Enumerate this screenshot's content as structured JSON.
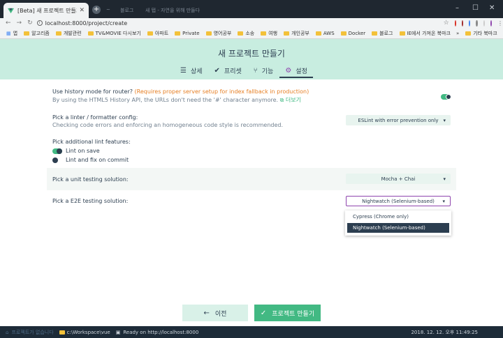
{
  "browser": {
    "tab_title": "[Beta] 새 프로젝트 만들기 - Vue",
    "dim_tabs": [
      "~",
      "블로그",
      "새 탭 - 자연을 위해 만들다"
    ],
    "url": "localhost:8000/project/create",
    "bookmarks": [
      "앱",
      "알고리즘",
      "개발관련",
      "TV&MOVIE 다시보기",
      "아파트",
      "Private",
      "영어공부",
      "소송",
      "여행",
      "개인공부",
      "AWS",
      "Docker",
      "블로그",
      "IE에서 가져온 북마크"
    ],
    "other_bookmarks": "기타 북마크"
  },
  "header": {
    "title": "새 프로젝트 만들기",
    "steps": [
      {
        "label": "상세",
        "icon": "list-icon"
      },
      {
        "label": "프리셋",
        "icon": "check-circle-icon"
      },
      {
        "label": "기능",
        "icon": "fork-icon"
      },
      {
        "label": "설정",
        "icon": "gear-icon"
      }
    ],
    "active_step": "설정"
  },
  "settings": {
    "history": {
      "label": "Use history mode for router?",
      "warning": "(Requires proper server setup for index fallback in production)",
      "desc": "By using the HTML5 History API, the URLs don't need the '#' character anymore.",
      "more": "더보기",
      "enabled": true
    },
    "linter": {
      "label": "Pick a linter / formatter config:",
      "desc": "Checking code errors and enforcing an homogeneous code style is recommended.",
      "value": "ESLint with error prevention only"
    },
    "lint_features": {
      "label": "Pick additional lint features:",
      "options": [
        {
          "label": "Lint on save",
          "enabled": true
        },
        {
          "label": "Lint and fix on commit",
          "enabled": false
        }
      ]
    },
    "unit": {
      "label": "Pick a unit testing solution:",
      "value": "Mocha + Chai"
    },
    "e2e": {
      "label": "Pick a E2E testing solution:",
      "value": "Nightwatch (Selenium-based)",
      "options": [
        "Cypress (Chrome only)",
        "Nightwatch (Selenium-based)"
      ]
    }
  },
  "buttons": {
    "prev": "이전",
    "create": "프로젝트 만들기"
  },
  "statusbar": {
    "left": "프로젝트가 없습니다",
    "path": "c:\\Workspace\\vue",
    "ready": "Ready on http://localhost:8000",
    "datetime": "2018. 12. 12. 오후 11:49:25"
  },
  "colors": {
    "accent": "#42b983",
    "header_bg": "#c8ede0",
    "text": "#2c3e50",
    "focus": "#8e44ad"
  }
}
